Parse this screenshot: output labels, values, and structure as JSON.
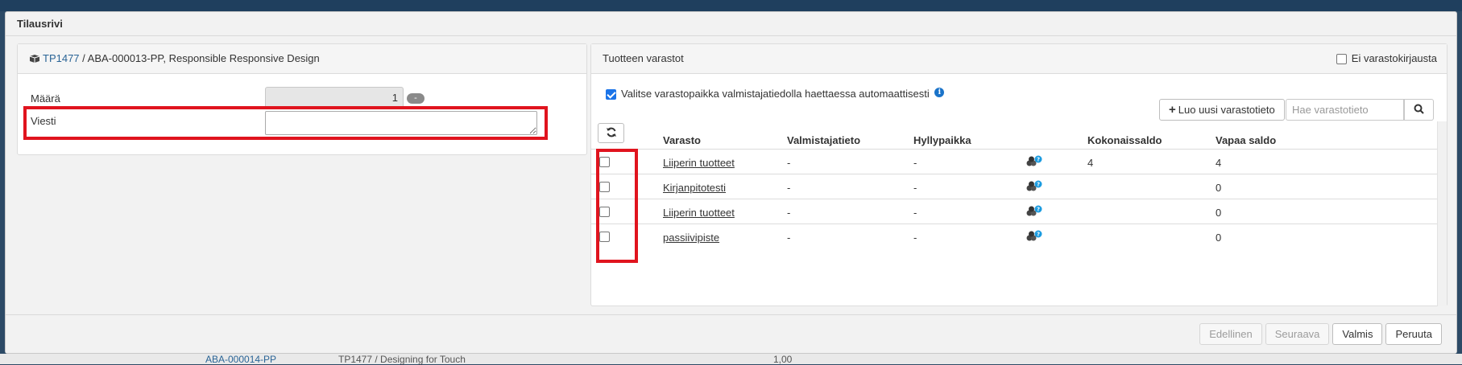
{
  "background": {
    "row_code": "ABA-000014-PP",
    "row_text": "TP1477 / Designing for Touch",
    "row_value": "1,00"
  },
  "modal": {
    "title": "Tilausrivi"
  },
  "product_panel": {
    "product_code": "TP1477",
    "product_desc": " / ABA-000013-PP, Responsible Responsive Design",
    "quantity_label": "Määrä",
    "quantity_value": "1",
    "quantity_minus": "-",
    "message_label": "Viesti",
    "message_value": ""
  },
  "stock_panel": {
    "title": "Tuotteen varastot",
    "no_stock_label": "Ei varastokirjausta",
    "no_stock_checked": false,
    "auto_select_label": "Valitse varastopaikka valmistajatiedolla haettaessa automaattisesti",
    "auto_select_checked": true,
    "info_icon": "i",
    "new_button_label": "Luo uusi varastotieto",
    "search_placeholder": "Hae varastotieto",
    "columns": [
      "Varasto",
      "Valmistajatieto",
      "Hyllypaikka",
      "Kokonaissaldo",
      "Vapaa saldo"
    ],
    "rows": [
      {
        "warehouse": "Liiperin tuotteet",
        "manufacturer": "-",
        "shelf": "-",
        "total": "4",
        "free": "4"
      },
      {
        "warehouse": "Kirjanpitotesti",
        "manufacturer": "-",
        "shelf": "-",
        "total": "",
        "free": "0"
      },
      {
        "warehouse": "Liiperin tuotteet",
        "manufacturer": "-",
        "shelf": "-",
        "total": "",
        "free": "0"
      },
      {
        "warehouse": "passiivipiste",
        "manufacturer": "-",
        "shelf": "-",
        "total": "",
        "free": "0"
      }
    ]
  },
  "footer": {
    "prev_label": "Edellinen",
    "next_label": "Seuraava",
    "done_label": "Valmis",
    "cancel_label": "Peruuta"
  },
  "colors": {
    "highlight": "#e0141e",
    "link": "#2a6496",
    "checkbox_on": "#1a73e8"
  },
  "icons": [
    "cube-icon",
    "info-icon",
    "plus-icon",
    "search-icon",
    "refresh-icon",
    "stock-info-icon"
  ]
}
